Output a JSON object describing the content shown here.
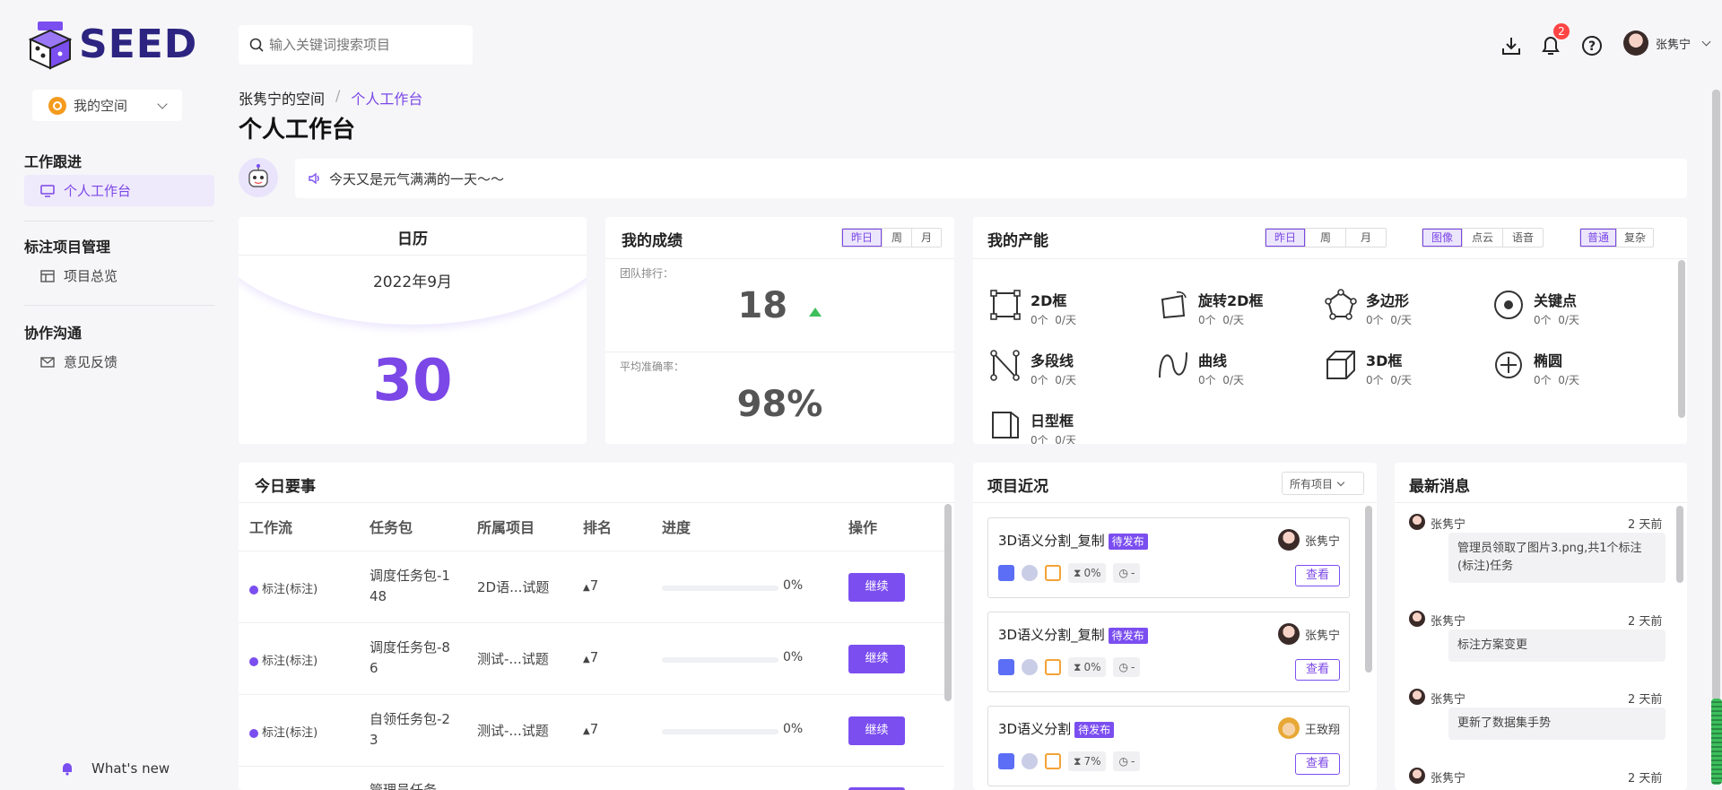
{
  "brand": {
    "name": "SEED"
  },
  "search": {
    "placeholder": "输入关键词搜索项目"
  },
  "header": {
    "notification_count": "2",
    "user_name": "张隽宁"
  },
  "space_selector": {
    "label": "我的空间"
  },
  "sidebar": {
    "sections": [
      {
        "title": "工作跟进",
        "items": [
          {
            "label": "个人工作台"
          }
        ]
      },
      {
        "title": "标注项目管理",
        "items": [
          {
            "label": "项目总览"
          }
        ]
      },
      {
        "title": "协作沟通",
        "items": [
          {
            "label": "意见反馈"
          }
        ]
      }
    ],
    "whats_new": "What's new"
  },
  "breadcrumb": {
    "root": "张隽宁的空间",
    "sep": "/",
    "current": "个人工作台"
  },
  "page_title": "个人工作台",
  "greeting": "今天又是元气满满的一天～～",
  "calendar": {
    "title": "日历",
    "month": "2022年9月",
    "day": "30"
  },
  "achievement": {
    "title": "我的成绩",
    "tabs": [
      "昨日",
      "周",
      "月"
    ],
    "rank_label": "团队排行：",
    "rank_value": "18",
    "accuracy_label": "平均准确率：",
    "accuracy_value": "98%"
  },
  "productivity": {
    "title": "我的产能",
    "period_tabs": [
      "昨日",
      "周",
      "月"
    ],
    "type_tabs": [
      "图像",
      "点云",
      "语音"
    ],
    "mode_tabs": [
      "普通",
      "复杂"
    ],
    "items": [
      {
        "name": "2D框",
        "count": "0个",
        "rate": "0/天",
        "icon": "box-2d-icon"
      },
      {
        "name": "旋转2D框",
        "count": "0个",
        "rate": "0/天",
        "icon": "rotate-box-icon"
      },
      {
        "name": "多边形",
        "count": "0个",
        "rate": "0/天",
        "icon": "polygon-icon"
      },
      {
        "name": "关键点",
        "count": "0个",
        "rate": "0/天",
        "icon": "keypoint-icon"
      },
      {
        "name": "多段线",
        "count": "0个",
        "rate": "0/天",
        "icon": "polyline-icon"
      },
      {
        "name": "曲线",
        "count": "0个",
        "rate": "0/天",
        "icon": "curve-icon"
      },
      {
        "name": "3D框",
        "count": "0个",
        "rate": "0/天",
        "icon": "cube-icon"
      },
      {
        "name": "椭圆",
        "count": "0个",
        "rate": "0/天",
        "icon": "ellipse-icon"
      },
      {
        "name": "日型框",
        "count": "0个",
        "rate": "0/天",
        "icon": "ri-box-icon"
      }
    ]
  },
  "today": {
    "title": "今日要事",
    "columns": [
      "工作流",
      "任务包",
      "所属项目",
      "排名",
      "进度",
      "操作"
    ],
    "rows": [
      {
        "workflow": "标注(标注)",
        "package_l1": "调度任务包-1",
        "package_l2": "48",
        "project": "2D语...试题",
        "rank": "7",
        "progress": "0%",
        "action": "继续"
      },
      {
        "workflow": "标注(标注)",
        "package_l1": "调度任务包-8",
        "package_l2": "6",
        "project": "测试-...试题",
        "rank": "7",
        "progress": "0%",
        "action": "继续"
      },
      {
        "workflow": "标注(标注)",
        "package_l1": "自领任务包-2",
        "package_l2": "3",
        "project": "测试-...试题",
        "rank": "7",
        "progress": "0%",
        "action": "继续"
      },
      {
        "workflow": "",
        "package_l1": "管理员任务",
        "package_l2": "",
        "project": "",
        "rank": "",
        "progress": "",
        "action": ""
      }
    ]
  },
  "projects": {
    "title": "项目近况",
    "filter": "所有项目",
    "cards": [
      {
        "name": "3D语义分割_复制",
        "status": "待发布",
        "owner": "张隽宁",
        "progress": "0%",
        "time": "-",
        "view": "查看"
      },
      {
        "name": "3D语义分割_复制",
        "status": "待发布",
        "owner": "张隽宁",
        "progress": "0%",
        "time": "-",
        "view": "查看"
      },
      {
        "name": "3D语义分割",
        "status": "待发布",
        "owner": "王致翔",
        "progress": "7%",
        "time": "-",
        "view": "查看"
      }
    ]
  },
  "messages": {
    "title": "最新消息",
    "items": [
      {
        "user": "张隽宁",
        "time": "2 天前",
        "text": "管理员领取了图片3.png,共1个标注(标注)任务"
      },
      {
        "user": "张隽宁",
        "time": "2 天前",
        "text": "标注方案变更"
      },
      {
        "user": "张隽宁",
        "time": "2 天前",
        "text": "更新了数据集手势"
      },
      {
        "user": "张隽宁",
        "time": "2 天前",
        "text": ""
      }
    ]
  },
  "colors": {
    "accent": "#7b4ef0",
    "up": "#3cbf5c"
  }
}
